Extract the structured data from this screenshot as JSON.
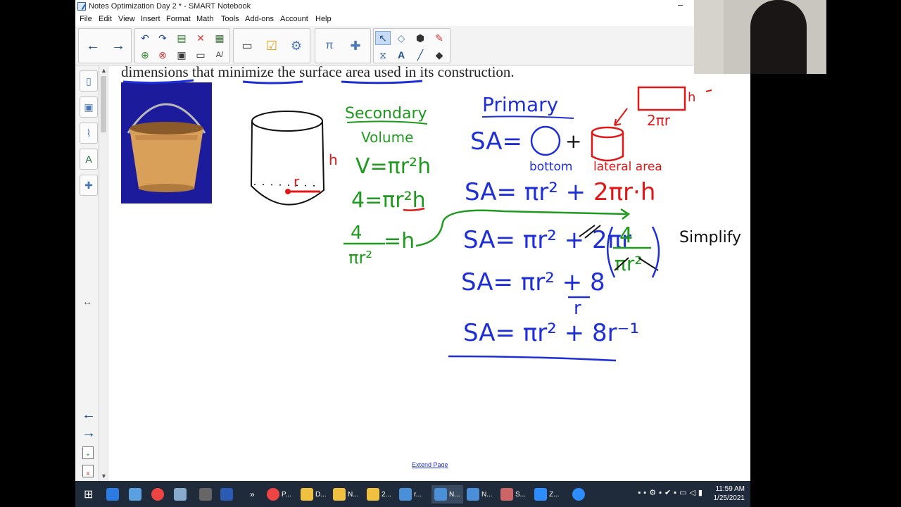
{
  "window": {
    "title": "Notes Optimization Day 2 * - SMART Notebook",
    "minimize_glyph": "–"
  },
  "menu": [
    "File",
    "Edit",
    "View",
    "Insert",
    "Format",
    "Math",
    "Tools",
    "Add-ons",
    "Account",
    "Help"
  ],
  "toolbar": {
    "back_icon": "arrow-left-icon",
    "forward_icon": "arrow-right-icon",
    "tools": [
      "undo-icon",
      "redo-icon",
      "paste-icon",
      "delete-icon",
      "table-icon",
      "add-page-icon",
      "delete-page-icon",
      "save-icon",
      "screen-shade-icon",
      "handwriting-icon",
      "display-icon",
      "response-icon",
      "addon-icon",
      "math-icon",
      "puzzle-icon",
      "select-icon",
      "shapes-icon",
      "fill-icon",
      "pen-icon",
      "measure-icon",
      "text-icon",
      "line-icon",
      "eraser-icon"
    ]
  },
  "side_tabs": [
    "page-sorter-icon",
    "gallery-icon",
    "attachments-icon",
    "properties-icon",
    "addons-icon"
  ],
  "canvas": {
    "question": "dimensions that minimize the surface area used in its construction.",
    "extend_link": "Extend Page"
  },
  "handwriting": {
    "secondary": "Secondary",
    "volume": "Volume",
    "v_eq": "V=πr²h",
    "four_eq": "4=πr²h",
    "four_over": "4",
    "pi_r2": "πr²",
    "eq_h": "=h",
    "primary": "Primary",
    "sa": "SA=",
    "plus": "+",
    "bottom": "bottom",
    "lateral": "lateral area",
    "two_pi_r": "2πr",
    "h": "h",
    "r": "r",
    "sa1": "SA= πr² + 2πr·h",
    "sa2": "SA= πr² + 2πr",
    "frac4": "4",
    "frac_den": "πr²",
    "simplify": "Simplify",
    "sa3": "SA= πr² + 8",
    "sa3_den": "r",
    "sa4": "SA= πr² + 8r⁻¹",
    "colors": {
      "blue": "#1f2fd6",
      "green": "#1e9a1e",
      "red": "#e01818",
      "black": "#111111"
    }
  },
  "taskbar": {
    "items": [
      "P...",
      "D...",
      "N...",
      "2...",
      "r...",
      "N...",
      "N...",
      "S...",
      "Z..."
    ],
    "time": "11:59 AM",
    "date": "1/25/2021"
  }
}
